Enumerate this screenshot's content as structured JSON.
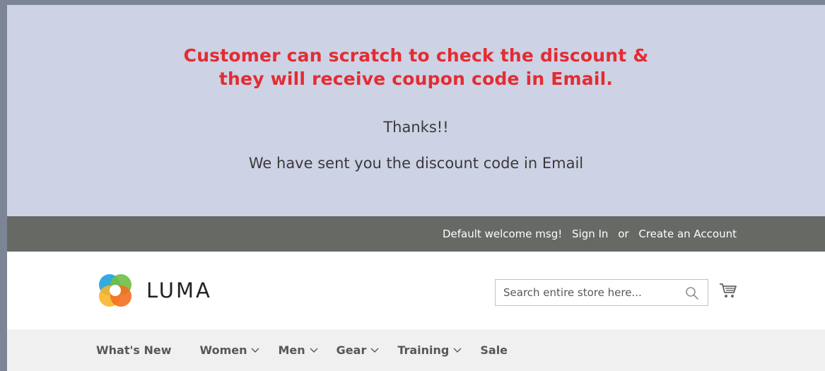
{
  "banner": {
    "annotation_line1": "Customer can scratch to check the discount &",
    "annotation_line2": "they will receive coupon code in Email.",
    "thanks": "Thanks!!",
    "message": "We have sent you the discount code in Email"
  },
  "panel": {
    "welcome": "Default welcome msg!",
    "sign_in": "Sign In",
    "or": "or",
    "create_account": "Create an Account"
  },
  "header": {
    "logo_text": "LUMA",
    "search_placeholder": "Search entire store here...",
    "search_icon": "search-icon",
    "cart_icon": "cart-icon"
  },
  "nav": {
    "items": [
      {
        "label": "What's New",
        "has_dropdown": false
      },
      {
        "label": "Women",
        "has_dropdown": true
      },
      {
        "label": "Men",
        "has_dropdown": true
      },
      {
        "label": "Gear",
        "has_dropdown": true
      },
      {
        "label": "Training",
        "has_dropdown": true
      },
      {
        "label": "Sale",
        "has_dropdown": false
      }
    ]
  },
  "colors": {
    "banner_bg": "#ced2e5",
    "annotation_red": "#e32c32",
    "panel_bg": "#676965",
    "nav_bg": "#f0f0f0"
  }
}
